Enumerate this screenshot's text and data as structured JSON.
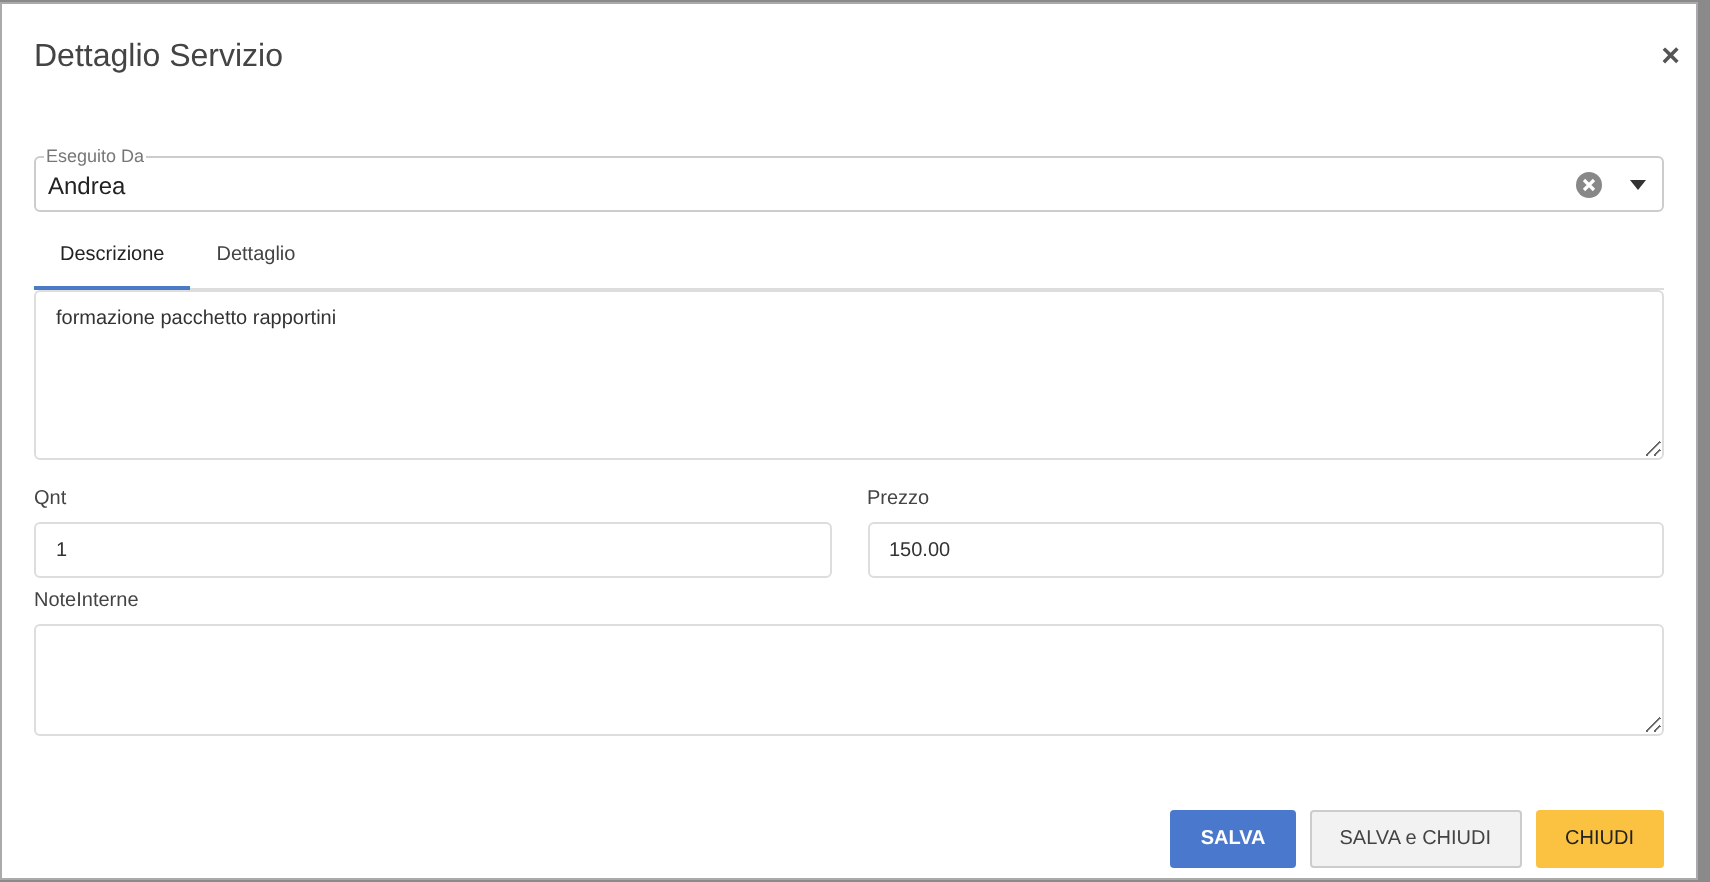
{
  "dialog": {
    "title": "Dettaglio Servizio",
    "close": "×"
  },
  "executed_by": {
    "label": "Eseguito Da",
    "value": "Andrea"
  },
  "tabs": [
    {
      "label": "Descrizione",
      "selected": true
    },
    {
      "label": "Dettaglio",
      "selected": false
    }
  ],
  "description": {
    "value": "formazione pacchetto rapportini"
  },
  "qty": {
    "label": "Qnt",
    "value": "1"
  },
  "price": {
    "label": "Prezzo",
    "value": "150.00"
  },
  "notes": {
    "label": "NoteInterne"
  },
  "buttons": [
    {
      "label": "SALVA",
      "kind": "primary"
    },
    {
      "label": "SALVA e CHIUDI",
      "kind": "default"
    },
    {
      "label": "CHIUDI",
      "kind": "warning"
    }
  ]
}
